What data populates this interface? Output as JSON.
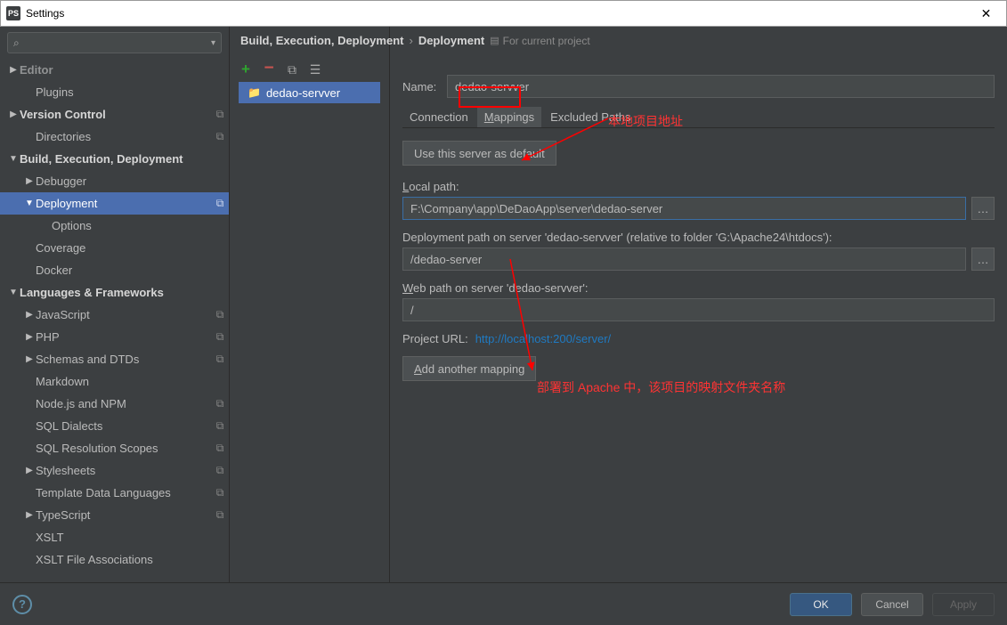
{
  "window": {
    "title": "Settings"
  },
  "search": {
    "placeholder": ""
  },
  "tree": [
    {
      "label": "Editor",
      "indent": 0,
      "arrow": "right",
      "bold": true,
      "dim": true,
      "copy": false
    },
    {
      "label": "Plugins",
      "indent": 1,
      "arrow": "",
      "bold": false,
      "copy": false
    },
    {
      "label": "Version Control",
      "indent": 0,
      "arrow": "right",
      "bold": true,
      "copy": true
    },
    {
      "label": "Directories",
      "indent": 1,
      "arrow": "",
      "bold": false,
      "copy": true
    },
    {
      "label": "Build, Execution, Deployment",
      "indent": 0,
      "arrow": "down",
      "bold": true,
      "copy": false
    },
    {
      "label": "Debugger",
      "indent": 1,
      "arrow": "right",
      "bold": false,
      "copy": false
    },
    {
      "label": "Deployment",
      "indent": 1,
      "arrow": "down",
      "bold": false,
      "copy": true,
      "selected": true
    },
    {
      "label": "Options",
      "indent": 2,
      "arrow": "",
      "bold": false,
      "copy": false
    },
    {
      "label": "Coverage",
      "indent": 1,
      "arrow": "",
      "bold": false,
      "copy": false
    },
    {
      "label": "Docker",
      "indent": 1,
      "arrow": "",
      "bold": false,
      "copy": false
    },
    {
      "label": "Languages & Frameworks",
      "indent": 0,
      "arrow": "down",
      "bold": true,
      "copy": false
    },
    {
      "label": "JavaScript",
      "indent": 1,
      "arrow": "right",
      "bold": false,
      "copy": true
    },
    {
      "label": "PHP",
      "indent": 1,
      "arrow": "right",
      "bold": false,
      "copy": true
    },
    {
      "label": "Schemas and DTDs",
      "indent": 1,
      "arrow": "right",
      "bold": false,
      "copy": true
    },
    {
      "label": "Markdown",
      "indent": 1,
      "arrow": "",
      "bold": false,
      "copy": false
    },
    {
      "label": "Node.js and NPM",
      "indent": 1,
      "arrow": "",
      "bold": false,
      "copy": true
    },
    {
      "label": "SQL Dialects",
      "indent": 1,
      "arrow": "",
      "bold": false,
      "copy": true
    },
    {
      "label": "SQL Resolution Scopes",
      "indent": 1,
      "arrow": "",
      "bold": false,
      "copy": true
    },
    {
      "label": "Stylesheets",
      "indent": 1,
      "arrow": "right",
      "bold": false,
      "copy": true
    },
    {
      "label": "Template Data Languages",
      "indent": 1,
      "arrow": "",
      "bold": false,
      "copy": true
    },
    {
      "label": "TypeScript",
      "indent": 1,
      "arrow": "right",
      "bold": false,
      "copy": true
    },
    {
      "label": "XSLT",
      "indent": 1,
      "arrow": "",
      "bold": false,
      "copy": false
    },
    {
      "label": "XSLT File Associations",
      "indent": 1,
      "arrow": "",
      "bold": false,
      "copy": false
    }
  ],
  "breadcrumb": {
    "main": "Build, Execution, Deployment",
    "sub": "Deployment",
    "project_scope": "For current project"
  },
  "servers": [
    {
      "name": "dedao-servver",
      "selected": true
    }
  ],
  "form": {
    "name_label": "Name:",
    "name_value": "dedao-servver",
    "tabs": {
      "connection": "Connection",
      "mappings": "Mappings",
      "excluded": "Excluded Paths",
      "mappings_underline": "M"
    },
    "default_btn": "Use this server as default",
    "local_path_label_pre": "L",
    "local_path_label_rest": "ocal path:",
    "local_path_value": "F:\\Company\\app\\DeDaoApp\\server\\dedao-server",
    "deploy_path_label": "Deployment path on server 'dedao-servver' (relative to folder 'G:\\Apache24\\htdocs'):",
    "deploy_path_value": "/dedao-server",
    "web_path_label_pre": "W",
    "web_path_label_rest": "eb path on server 'dedao-servver':",
    "web_path_value": "/",
    "project_url_label": "Project URL:",
    "project_url_value": "http://localhost:200/server/",
    "add_mapping_btn_pre": "A",
    "add_mapping_btn_rest": "dd another mapping"
  },
  "annotations": {
    "top": "本地项目地址",
    "bottom": "部署到 Apache 中，该项目的映射文件夹名称"
  },
  "footer": {
    "ok": "OK",
    "cancel": "Cancel",
    "apply": "Apply"
  }
}
